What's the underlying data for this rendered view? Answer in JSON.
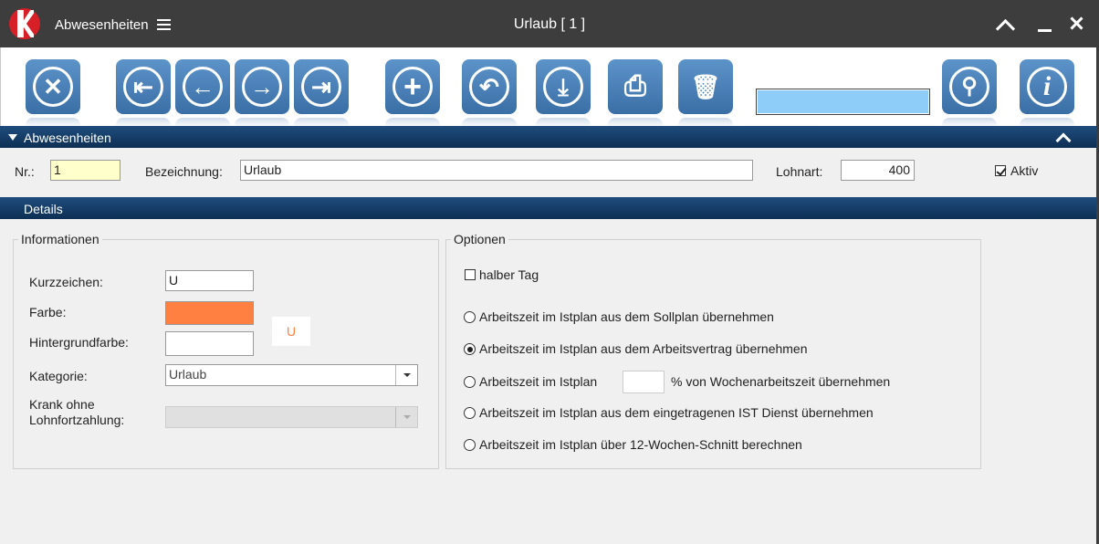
{
  "titlebar": {
    "app_title": "Abwesenheiten",
    "window_title": "Urlaub  [ 1 ]"
  },
  "toolbar": {
    "buttons": [
      {
        "name": "cancel-button",
        "icon": "close-icon",
        "glyph": "✕"
      },
      {
        "name": "first-record-button",
        "icon": "first-icon",
        "glyph": "⇤"
      },
      {
        "name": "previous-record-button",
        "icon": "arrow-left-icon",
        "glyph": "←"
      },
      {
        "name": "next-record-button",
        "icon": "arrow-right-icon",
        "glyph": "→"
      },
      {
        "name": "last-record-button",
        "icon": "last-icon",
        "glyph": "⇥"
      },
      {
        "name": "add-button",
        "icon": "plus-icon",
        "glyph": "+"
      },
      {
        "name": "undo-button",
        "icon": "undo-icon",
        "glyph": "↶"
      },
      {
        "name": "save-button",
        "icon": "download-icon",
        "glyph": "⤓"
      },
      {
        "name": "print-button",
        "icon": "printer-icon",
        "glyph": "⎙"
      },
      {
        "name": "delete-button",
        "icon": "trash-icon",
        "glyph": "🗑"
      },
      {
        "name": "search-button",
        "icon": "search-icon",
        "glyph": "⚲"
      },
      {
        "name": "info-button",
        "icon": "info-icon",
        "glyph": "i"
      }
    ],
    "search_value": ""
  },
  "header_section": {
    "title": "Abwesenheiten",
    "nr_label": "Nr.:",
    "nr_value": "1",
    "bezeichnung_label": "Bezeichnung:",
    "bezeichnung_value": "Urlaub",
    "lohnart_label": "Lohnart:",
    "lohnart_value": "400",
    "aktiv_label": "Aktiv",
    "aktiv_checked": true
  },
  "details_section": {
    "title": "Details",
    "informationen": {
      "title": "Informationen",
      "kurzzeichen_label": "Kurzzeichen:",
      "kurzzeichen_value": "U",
      "farbe_label": "Farbe:",
      "farbe_color": "#ff8040",
      "hintergrundfarbe_label": "Hintergrundfarbe:",
      "hintergrundfarbe_color": "#ffffff",
      "preview_text": "U",
      "kategorie_label": "Kategorie:",
      "kategorie_value": "Urlaub",
      "krank_label_line1": "Krank ohne",
      "krank_label_line2": "Lohnfortzahlung:",
      "krank_value": ""
    },
    "optionen": {
      "title": "Optionen",
      "halber_tag_label": "halber Tag",
      "halber_tag_checked": false,
      "radio_sollplan": "Arbeitszeit im Istplan aus dem Sollplan übernehmen",
      "radio_arbeitsvertrag": "Arbeitszeit im Istplan aus dem Arbeitsvertrag übernehmen",
      "radio_prozent_prefix": "Arbeitszeit im Istplan",
      "radio_prozent_value": "",
      "radio_prozent_suffix": "% von Wochenarbeitszeit übernehmen",
      "radio_ist_dienst": "Arbeitszeit im Istplan aus dem eingetragenen IST Dienst übernehmen",
      "radio_12_wochen": "Arbeitszeit im Istplan über 12-Wochen-Schnitt berechnen",
      "selected": "arbeitsvertrag"
    }
  },
  "colors": {
    "titlebar_bg": "#3d3d3d",
    "button_blue": "#4a80b8",
    "section_header": "#1a4370",
    "accent_orange": "#ff8040"
  }
}
